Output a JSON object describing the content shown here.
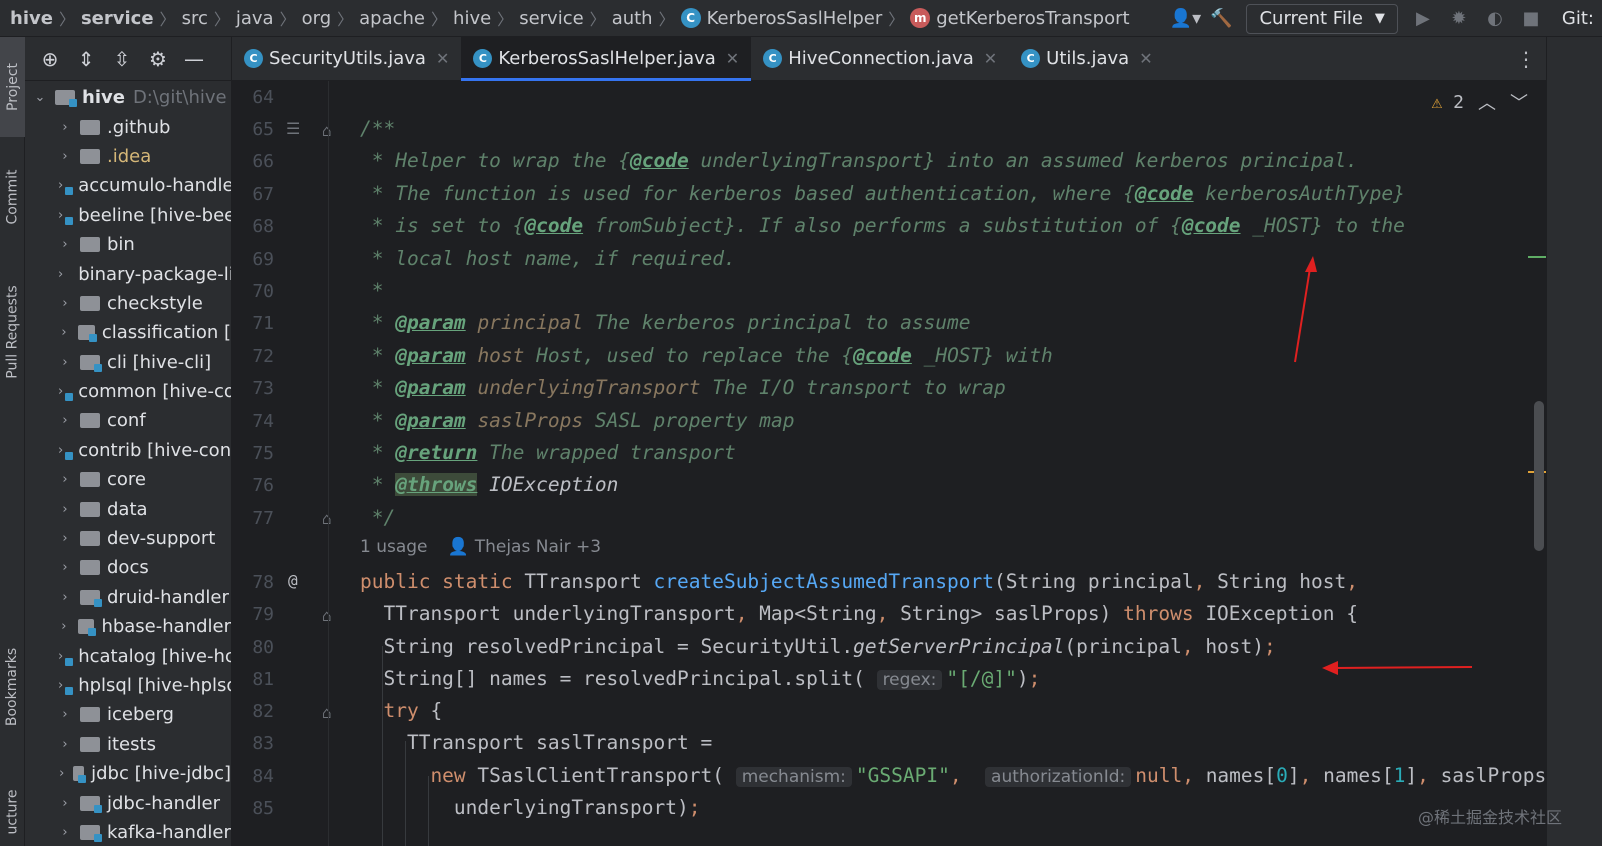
{
  "breadcrumbs": [
    "hive",
    "service",
    "src",
    "java",
    "org",
    "apache",
    "hive",
    "service",
    "auth",
    "KerberosSaslHelper",
    "getKerberosTransport"
  ],
  "toolbar": {
    "run_config": "Current File",
    "vcs_label": "Git:"
  },
  "toolstrip": {
    "project": "Project",
    "commit": "Commit",
    "pull_requests": "Pull Requests",
    "bookmarks": "Bookmarks",
    "structure": "ucture"
  },
  "project": {
    "root": {
      "name": "hive",
      "path": "D:\\git\\hive"
    },
    "items": [
      {
        "name": ".github",
        "type": "folder"
      },
      {
        "name": ".idea",
        "type": "folder-idea"
      },
      {
        "name": "accumulo-handler",
        "type": "module"
      },
      {
        "name": "beeline [hive-beeline]",
        "type": "module"
      },
      {
        "name": "bin",
        "type": "folder"
      },
      {
        "name": "binary-package-licenses",
        "type": "folder"
      },
      {
        "name": "checkstyle",
        "type": "folder"
      },
      {
        "name": "classification [",
        "type": "module"
      },
      {
        "name": "cli [hive-cli]",
        "type": "module"
      },
      {
        "name": "common [hive-common]",
        "type": "module"
      },
      {
        "name": "conf",
        "type": "folder"
      },
      {
        "name": "contrib [hive-contrib]",
        "type": "module"
      },
      {
        "name": "core",
        "type": "folder"
      },
      {
        "name": "data",
        "type": "folder"
      },
      {
        "name": "dev-support",
        "type": "folder"
      },
      {
        "name": "docs",
        "type": "folder"
      },
      {
        "name": "druid-handler",
        "type": "module"
      },
      {
        "name": "hbase-handler",
        "type": "module"
      },
      {
        "name": "hcatalog [hive-hcatalog]",
        "type": "module"
      },
      {
        "name": "hplsql [hive-hplsql]",
        "type": "module"
      },
      {
        "name": "iceberg",
        "type": "folder"
      },
      {
        "name": "itests",
        "type": "folder"
      },
      {
        "name": "jdbc [hive-jdbc]",
        "type": "module"
      },
      {
        "name": "jdbc-handler",
        "type": "module"
      },
      {
        "name": "kafka-handler",
        "type": "module"
      }
    ]
  },
  "tabs": [
    {
      "label": "SecurityUtils.java",
      "active": false
    },
    {
      "label": "KerberosSaslHelper.java",
      "active": true
    },
    {
      "label": "HiveConnection.java",
      "active": false
    },
    {
      "label": "Utils.java",
      "active": false
    }
  ],
  "editor": {
    "warnings_count": "2",
    "line_numbers": [
      "64",
      "65",
      "66",
      "67",
      "68",
      "69",
      "70",
      "71",
      "72",
      "73",
      "74",
      "75",
      "76",
      "77",
      "78",
      "79",
      "80",
      "81",
      "82",
      "83",
      "84",
      "85"
    ],
    "inlay": {
      "usages": "1 usage",
      "author": "Thejas Nair +3"
    },
    "hints": {
      "regex": "regex:",
      "mechanism": "mechanism:",
      "authorization_id": "authorizationId:"
    }
  },
  "watermark": "@稀土掘金技术社区",
  "colors": {
    "comment": "#5f826b",
    "keyword": "#cf8e6d",
    "function": "#56a8f5",
    "string": "#6aab73",
    "number": "#2aacb8",
    "accent": "#3574f0",
    "annotation_arrow": "#e02020"
  }
}
